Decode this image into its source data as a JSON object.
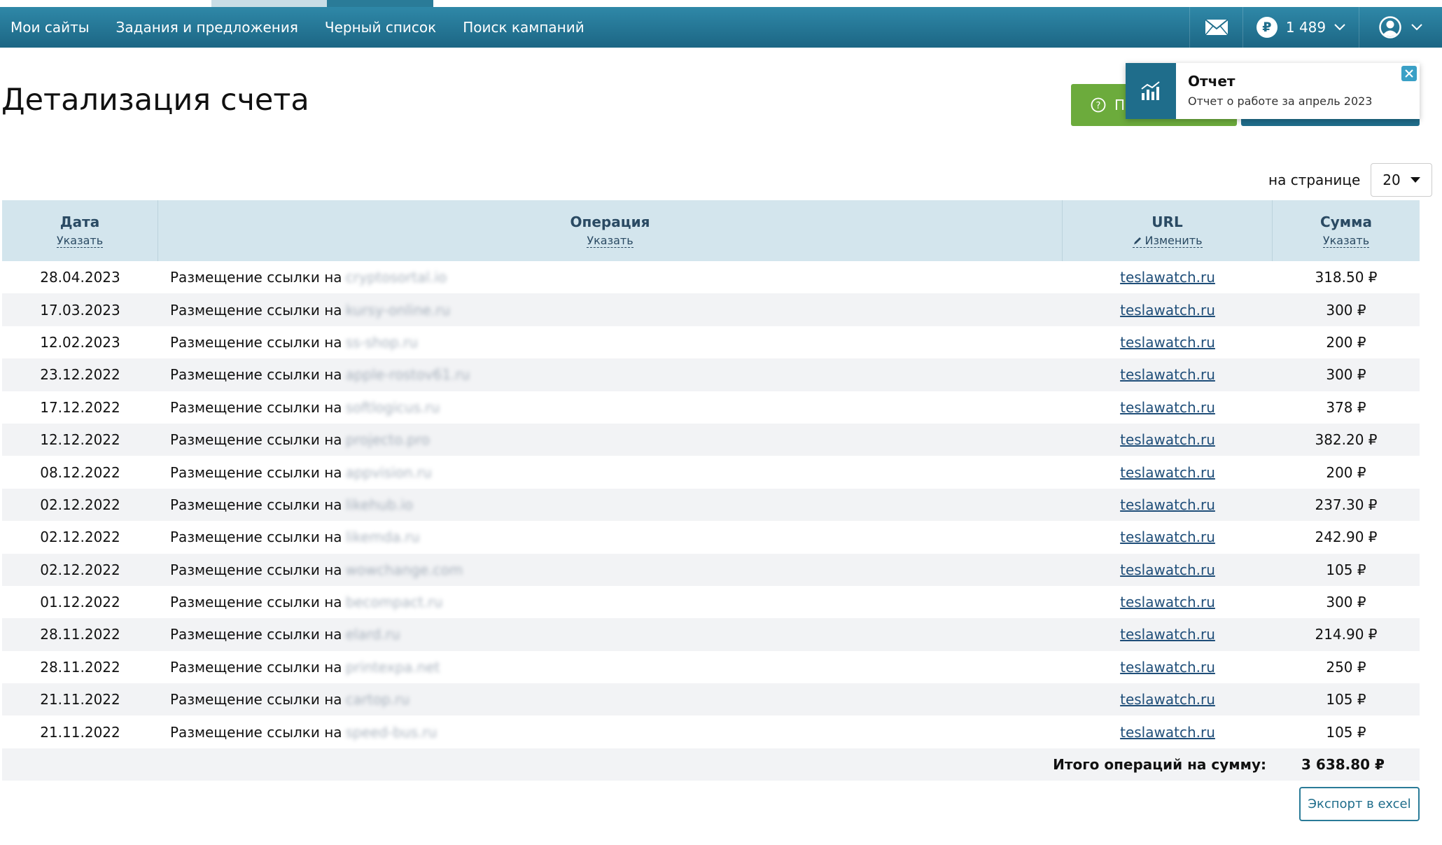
{
  "nav": {
    "items": [
      "Мои сайты",
      "Задания и предложения",
      "Черный список",
      "Поиск кампаний"
    ],
    "balance": "1 489",
    "icons": {
      "mail": "mail-icon",
      "ruble": "ruble-icon",
      "user": "user-avatar-icon",
      "chevron": "chevron-down-icon"
    }
  },
  "page": {
    "title": "Детализация счета",
    "help_button_label": "По"
  },
  "toast": {
    "title": "Отчет",
    "text": "Отчет о работе за апрель 2023"
  },
  "per_page": {
    "label": "на странице",
    "value": "20"
  },
  "table": {
    "columns": [
      {
        "title": "Дата",
        "link": "Указать"
      },
      {
        "title": "Операция",
        "link": "Указать"
      },
      {
        "title": "URL",
        "link": "Изменить"
      },
      {
        "title": "Сумма",
        "link": "Указать"
      }
    ],
    "rows": [
      {
        "date": "28.04.2023",
        "op": "Размещение ссылки на",
        "site": "cryptosortal.io",
        "url": "teslawatch.ru",
        "sum": "318.50 ₽"
      },
      {
        "date": "17.03.2023",
        "op": "Размещение ссылки на",
        "site": "kursy-online.ru",
        "url": "teslawatch.ru",
        "sum": "300 ₽"
      },
      {
        "date": "12.02.2023",
        "op": "Размещение ссылки на",
        "site": "ss-shop.ru",
        "url": "teslawatch.ru",
        "sum": "200 ₽"
      },
      {
        "date": "23.12.2022",
        "op": "Размещение ссылки на",
        "site": "apple-rostov61.ru",
        "url": "teslawatch.ru",
        "sum": "300 ₽"
      },
      {
        "date": "17.12.2022",
        "op": "Размещение ссылки на",
        "site": "softlogicus.ru",
        "url": "teslawatch.ru",
        "sum": "378 ₽"
      },
      {
        "date": "12.12.2022",
        "op": "Размещение ссылки на",
        "site": "projecto.pro",
        "url": "teslawatch.ru",
        "sum": "382.20 ₽"
      },
      {
        "date": "08.12.2022",
        "op": "Размещение ссылки на",
        "site": "appvision.ru",
        "url": "teslawatch.ru",
        "sum": "200 ₽"
      },
      {
        "date": "02.12.2022",
        "op": "Размещение ссылки на",
        "site": "likehub.io",
        "url": "teslawatch.ru",
        "sum": "237.30 ₽"
      },
      {
        "date": "02.12.2022",
        "op": "Размещение ссылки на",
        "site": "likemda.ru",
        "url": "teslawatch.ru",
        "sum": "242.90 ₽"
      },
      {
        "date": "02.12.2022",
        "op": "Размещение ссылки на",
        "site": "wowchange.com",
        "url": "teslawatch.ru",
        "sum": "105 ₽"
      },
      {
        "date": "01.12.2022",
        "op": "Размещение ссылки на",
        "site": "becompact.ru",
        "url": "teslawatch.ru",
        "sum": "300 ₽"
      },
      {
        "date": "28.11.2022",
        "op": "Размещение ссылки на",
        "site": "elard.ru",
        "url": "teslawatch.ru",
        "sum": "214.90 ₽"
      },
      {
        "date": "28.11.2022",
        "op": "Размещение ссылки на",
        "site": "printexpa.net",
        "url": "teslawatch.ru",
        "sum": "250 ₽"
      },
      {
        "date": "21.11.2022",
        "op": "Размещение ссылки на",
        "site": "cartop.ru",
        "url": "teslawatch.ru",
        "sum": "105 ₽"
      },
      {
        "date": "21.11.2022",
        "op": "Размещение ссылки на",
        "site": "speed-bus.ru",
        "url": "teslawatch.ru",
        "sum": "105 ₽"
      }
    ],
    "total_label": "Итого операций на сумму:",
    "total_value": "3 638.80 ₽"
  },
  "export_label": "Экспорт в excel",
  "colors": {
    "nav": "#1f6d8b",
    "help_button": "#6cab3c",
    "header_bg": "#d3e5ed",
    "link": "#1f4e79"
  }
}
